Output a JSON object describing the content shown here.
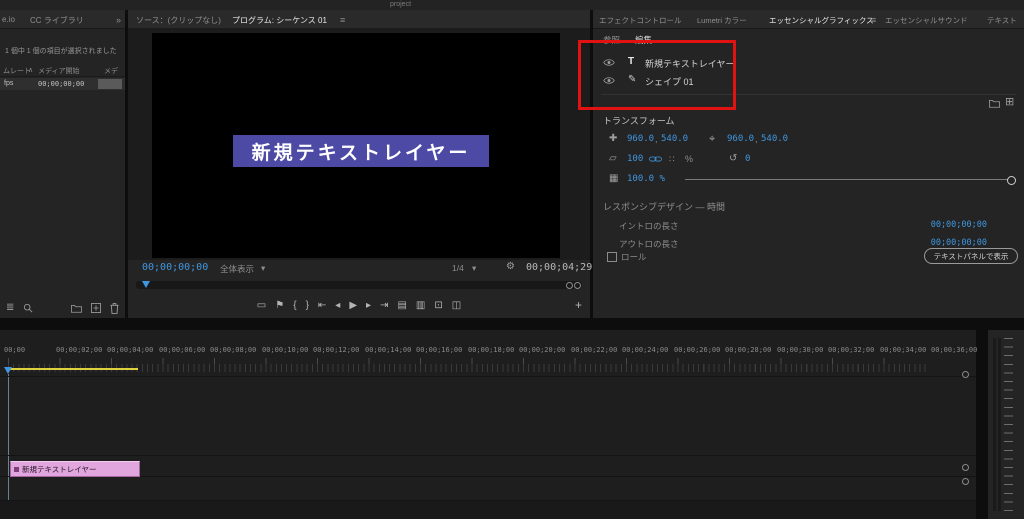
{
  "window": {
    "title": "project"
  },
  "colors": {
    "accent_blue": "#3f97e0",
    "banner_purple": "#4c4aa5",
    "clip_pink": "#e2a6df",
    "annotation_red": "#e01312",
    "work_area_yellow": "#ddd13e"
  },
  "project_panel": {
    "tabs": {
      "frameio": "e.io",
      "cc_libraries": "CC ライブラリ"
    },
    "overflow_icon": "»",
    "status": "1 個中 1 個の項目が選択されました",
    "columns": {
      "framerate": "ムレート",
      "media_start": "メディア開始",
      "media": "メデ"
    },
    "sort_icon": "∧",
    "row": {
      "framerate": "fps",
      "media_start": "00;00;00;00"
    },
    "toolbar": {
      "list_view": "≣"
    }
  },
  "monitor": {
    "source_tab": "ソース：(クリップなし)",
    "program_tab": "プログラム: シーケンス 01",
    "menu_icon": "≡",
    "overlay_text": "新規テキストレイヤー",
    "current_timecode": "00;00;00;00",
    "zoom_level": "全体表示",
    "dropdown_icon": "▾",
    "playback_resolution": "1/4",
    "wrench_icon": "⚙",
    "duration_timecode": "00;00;04;29",
    "transport": {
      "safe_margins": "▭",
      "add_marker": "⚑",
      "mark_in": "{",
      "mark_out": "}",
      "go_to_in": "⇤",
      "step_back": "◂",
      "play": "▶",
      "step_forward": "▸",
      "go_to_out": "⇥",
      "lift": "▤",
      "extract": "▥",
      "export_frame": "⊡",
      "comparison_view": "◫",
      "button_editor": "+"
    }
  },
  "right_panel": {
    "tabs": {
      "effect_controls": "エフェクトコントロール",
      "lumetri": "Lumetri カラー",
      "essential_graphics": "エッセンシャルグラフィックス",
      "essential_sound": "エッセンシャルサウンド",
      "text": "テキスト"
    },
    "menu_icon": "≡",
    "subtabs": {
      "browse": "参照",
      "edit": "編集"
    },
    "layers": [
      {
        "type_icon": "T",
        "label": "新規テキストレイヤー"
      },
      {
        "type_icon": "✎",
        "label": "シェイプ 01"
      }
    ],
    "new_layer_icon": "⊞",
    "transform": {
      "title": "トランスフォーム",
      "position_icon": "✚",
      "position_x": "960.0",
      "position_y": "540.0",
      "anchor_icon": "⌖",
      "anchor_x": "960.0",
      "anchor_y": "540.0",
      "comma": ",",
      "scale_icon": "▱",
      "scale": "100",
      "scale_dots": "∷",
      "percent_sign": "%",
      "rotate_icon": "↺",
      "rotation": "0",
      "opacity_icon": "▦",
      "opacity": "100.0 %"
    },
    "responsive": {
      "title": "レスポンシブデザイン — 時間",
      "intro_label": "イントロの長さ",
      "intro_value": "00;00;00;00",
      "outro_label": "アウトロの長さ",
      "outro_value": "00;00;00;00",
      "roll_label": "ロール"
    },
    "footer_button": "テキストパネルで表示"
  },
  "timeline": {
    "ruler": [
      "00;00",
      "00;00;02;00",
      "00;00;04;00",
      "00;00;06;00",
      "00;00;08;00",
      "00;00;10;00",
      "00;00;12;00",
      "00;00;14;00",
      "00;00;16;00",
      "00;00;18;00",
      "00;00;20;00",
      "00;00;22;00",
      "00;00;24;00",
      "00;00;26;00",
      "00;00;28;00",
      "00;00;30;00",
      "00;00;32;00",
      "00;00;34;00",
      "00;00;36;00"
    ],
    "clip": {
      "label": "新規テキストレイヤー"
    }
  }
}
